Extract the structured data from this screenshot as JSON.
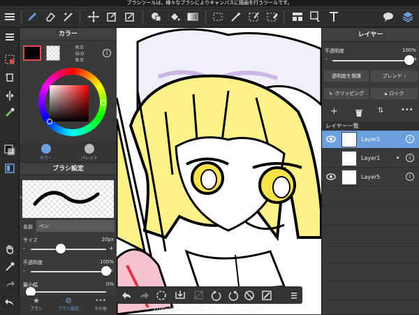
{
  "status_bar": {
    "text": "ブラシツールは、様々なブラシによりキャンバスに描画を行うツールです。"
  },
  "toolbar": {
    "icons": [
      "menu-icon",
      "brush-icon",
      "eraser-icon",
      "smudge-icon",
      "move-icon",
      "transform-icon",
      "free-transform-icon",
      "fill-icon",
      "bucket-icon",
      "gradient-icon",
      "select-rect-icon",
      "magic-wand-icon",
      "select-pen-icon",
      "select-eraser-icon",
      "filter-icon",
      "operation-icon",
      "text-icon",
      "chat-icon",
      "layers-icon"
    ]
  },
  "color_panel": {
    "title": "カラー",
    "rgb": {
      "r": "R:0",
      "g": "G:0",
      "b": "B:0"
    },
    "tabs": [
      {
        "label": "カラー"
      },
      {
        "label": "パレット"
      }
    ]
  },
  "brush_panel": {
    "title": "ブラシ設定",
    "name_label": "名前",
    "name_value": "ペン",
    "size_label": "サイズ",
    "size_value": "20px",
    "opacity_label": "不透明度",
    "opacity_value": "100%",
    "min_width_label": "最小幅",
    "min_width_value": "0%",
    "tabs": [
      {
        "label": "ブラシ"
      },
      {
        "label": "ブラシ設定"
      },
      {
        "label": "その他"
      }
    ],
    "size_fraction": 0.4,
    "opacity_fraction": 1.0,
    "min_width_fraction": 0.0
  },
  "canvas": {
    "status": "2100x2800px 192dpi 156% ブラシ 20px 100%"
  },
  "layer_panel": {
    "title": "レイヤー",
    "opacity_label": "不透明度",
    "opacity_value": "100%",
    "opacity_fraction": 1.0,
    "protect_alpha_label": "透明度を保護",
    "blend_label": "ブレンド",
    "clipping_label": "クリッピング",
    "lock_label": "ロック",
    "list_header": "レイヤー一覧",
    "layers": [
      {
        "name": "Layer2",
        "visible": true,
        "selected": true,
        "locked": false
      },
      {
        "name": "Layer1",
        "visible": false,
        "selected": false,
        "locked": true
      },
      {
        "name": "Layer5",
        "visible": true,
        "selected": false,
        "locked": false
      }
    ]
  },
  "colors": {
    "accent": "#6fa0e0",
    "selected_layer": "#6b9fde",
    "panel_bg": "#3a3a3a"
  }
}
